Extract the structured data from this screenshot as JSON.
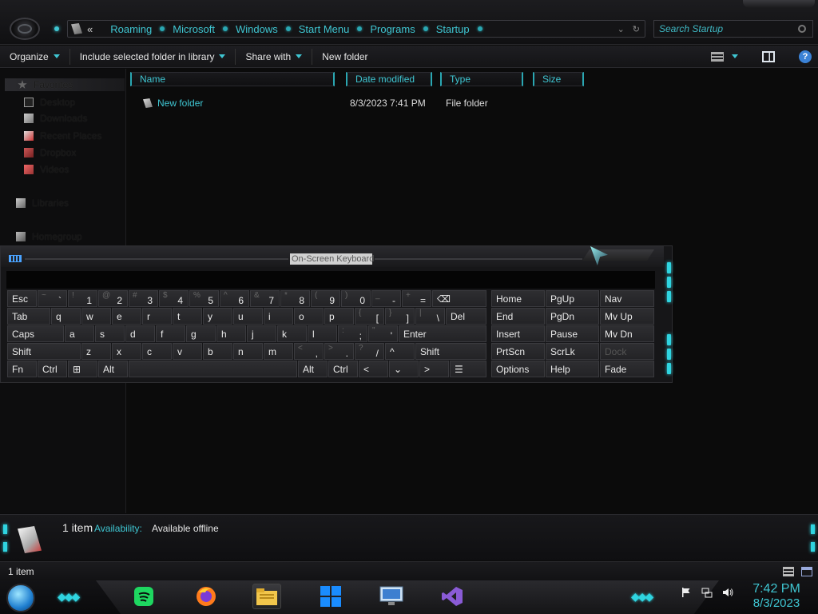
{
  "address": {
    "back_chevron": "«",
    "crumbs": [
      "Roaming",
      "Microsoft",
      "Windows",
      "Start Menu",
      "Programs",
      "Startup"
    ],
    "search_placeholder": "Search Startup"
  },
  "toolbar": {
    "organize": "Organize",
    "include_library": "Include selected folder in library",
    "share_with": "Share with",
    "new_folder": "New folder",
    "help": "?"
  },
  "navpane": {
    "header": "Favorites",
    "items": [
      "Desktop",
      "Downloads",
      "Recent Places",
      "Dropbox",
      "Videos"
    ],
    "libraries": "Libraries",
    "homegroup": "Homegroup"
  },
  "columns": [
    "Name",
    "Date modified",
    "Type",
    "Size"
  ],
  "files": [
    {
      "name": "New folder",
      "date": "8/3/2023 7:41 PM",
      "type": "File folder",
      "size": ""
    }
  ],
  "osk": {
    "title": "On-Screen Keyboard",
    "row1": [
      {
        "m": "Esc"
      },
      {
        "s": "~",
        "b": "`"
      },
      {
        "s": "!",
        "b": "1"
      },
      {
        "s": "@",
        "b": "2"
      },
      {
        "s": "#",
        "b": "3"
      },
      {
        "s": "$",
        "b": "4"
      },
      {
        "s": "%",
        "b": "5"
      },
      {
        "s": "^",
        "b": "6"
      },
      {
        "s": "&",
        "b": "7"
      },
      {
        "s": "*",
        "b": "8"
      },
      {
        "s": "(",
        "b": "9"
      },
      {
        "s": ")",
        "b": "0"
      },
      {
        "s": "_",
        "b": "-"
      },
      {
        "s": "+",
        "b": "="
      },
      {
        "m": "⌫"
      }
    ],
    "row2": [
      {
        "m": "Tab"
      },
      {
        "m": "q"
      },
      {
        "m": "w"
      },
      {
        "m": "e"
      },
      {
        "m": "r"
      },
      {
        "m": "t"
      },
      {
        "m": "y"
      },
      {
        "m": "u"
      },
      {
        "m": "i"
      },
      {
        "m": "o"
      },
      {
        "m": "p"
      },
      {
        "s": "{",
        "b": "["
      },
      {
        "s": "}",
        "b": "]"
      },
      {
        "s": "|",
        "b": "\\"
      },
      {
        "m": "Del"
      }
    ],
    "row3": [
      {
        "m": "Caps"
      },
      {
        "m": "a"
      },
      {
        "m": "s"
      },
      {
        "m": "d"
      },
      {
        "m": "f"
      },
      {
        "m": "g"
      },
      {
        "m": "h"
      },
      {
        "m": "j"
      },
      {
        "m": "k"
      },
      {
        "m": "l"
      },
      {
        "s": ":",
        "b": ";"
      },
      {
        "s": "\"",
        "b": "'"
      },
      {
        "m": "Enter"
      }
    ],
    "row4": [
      {
        "m": "Shift"
      },
      {
        "m": "z"
      },
      {
        "m": "x"
      },
      {
        "m": "c"
      },
      {
        "m": "v"
      },
      {
        "m": "b"
      },
      {
        "m": "n"
      },
      {
        "m": "m"
      },
      {
        "s": "<",
        "b": ","
      },
      {
        "s": ">",
        "b": "."
      },
      {
        "s": "?",
        "b": "/"
      },
      {
        "m": "^"
      },
      {
        "m": "Shift"
      }
    ],
    "row5": [
      {
        "m": "Fn"
      },
      {
        "m": "Ctrl"
      },
      {
        "m": "⊞"
      },
      {
        "m": "Alt"
      },
      {
        "m": ""
      },
      {
        "m": "Alt"
      },
      {
        "m": "Ctrl"
      },
      {
        "m": "<"
      },
      {
        "m": "⌄"
      },
      {
        "m": ">"
      },
      {
        "m": "☰"
      }
    ],
    "nav": [
      [
        "Home",
        "PgUp",
        "Nav"
      ],
      [
        "End",
        "PgDn",
        "Mv Up"
      ],
      [
        "Insert",
        "Pause",
        "Mv Dn"
      ],
      [
        "PrtScn",
        "ScrLk",
        "Dock"
      ],
      [
        "Options",
        "Help",
        "Fade"
      ]
    ]
  },
  "details": {
    "count": "1 item",
    "availability_label": "Availability:",
    "availability_value": "Available offline"
  },
  "status": {
    "text": "1 item"
  },
  "clock": {
    "time": "7:42 PM",
    "date": "8/3/2023"
  },
  "taskbar_apps": [
    "spotify",
    "firefox",
    "file-explorer",
    "windows-store",
    "remote-desktop",
    "visual-studio"
  ]
}
